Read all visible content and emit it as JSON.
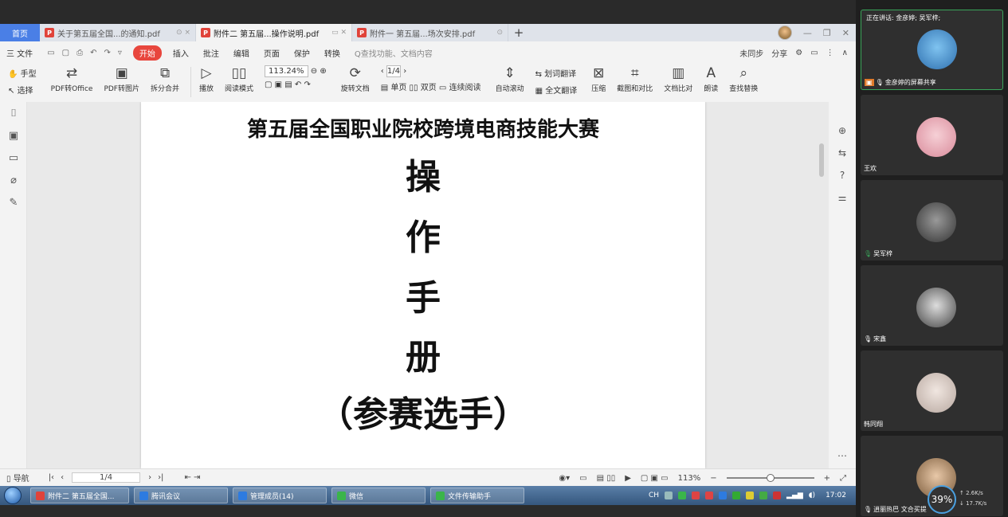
{
  "wps": {
    "tabs": {
      "home": "首页",
      "tab1": "关于第五届全国...的通知.pdf",
      "tab2": "附件二 第五届...操作说明.pdf",
      "tab3": "附件一 第五届...场次安排.pdf",
      "add": "+"
    },
    "menu": {
      "file": "三 文件",
      "start": "开始",
      "insert": "插入",
      "annotate": "批注",
      "edit": "编辑",
      "page": "页面",
      "protect": "保护",
      "convert": "转换",
      "search_placeholder": "Q查找功能、文档内容",
      "unsynced": "未同步",
      "share": "分享"
    },
    "ribbon": {
      "hand": "手型",
      "select": "选择",
      "pdf_to_office": "PDF转Office",
      "pdf_to_image": "PDF转图片",
      "split_merge": "拆分合并",
      "play": "播放",
      "read_mode": "阅读模式",
      "zoom": "113.24%",
      "rotate": "旋转文档",
      "page_indicator": "1/4",
      "single_page": "单页",
      "double_page": "双页",
      "continuous": "连续阅读",
      "auto_scroll": "自动滚动",
      "word_translate": "划词翻译",
      "full_translate": "全文翻译",
      "compress": "压缩",
      "screenshot_compare": "截图和对比",
      "doc_compare": "文档比对",
      "read_aloud": "朗读",
      "find_replace": "查找替换"
    },
    "document": {
      "title": "第五届全国职业院校跨境电商技能大赛",
      "char1": "操",
      "char2": "作",
      "char3": "手",
      "char4": "册",
      "subtitle": "（参赛选手）"
    },
    "status": {
      "nav": "导航",
      "page": "1/4",
      "zoom": "113%"
    }
  },
  "taskbar": {
    "tasks": [
      "附件二 第五届全国...",
      "腾讯会议",
      "管理成员(14)",
      "微信",
      "文件传输助手"
    ],
    "tray_lang": "CH",
    "clock": "17:02"
  },
  "meeting": {
    "speaker_line": "正在讲话: 金彦婷; 吴军梓;",
    "participants": [
      {
        "name": "金彦婷的屏幕共享"
      },
      {
        "name": "王欢"
      },
      {
        "name": "吴军梓"
      },
      {
        "name": "宋鑫"
      },
      {
        "name": "韩同翔"
      },
      {
        "name": "逍丽热巴 文合买提"
      }
    ],
    "net_percent": "39%",
    "net_up": "↑ 2.6K/s",
    "net_down": "↓ 17.7K/s"
  },
  "colors": {
    "accent": "#4a7fe6",
    "start_red": "#e8463d",
    "speaking_green": "#3aa55a"
  }
}
